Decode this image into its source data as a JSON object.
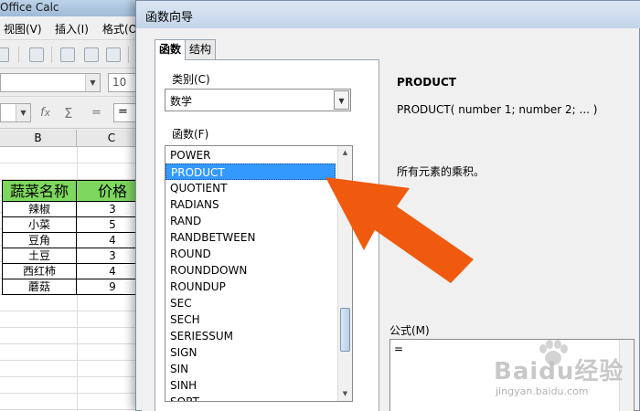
{
  "calc": {
    "title": "Office Calc",
    "menu": [
      "视图(V)",
      "插入(I)",
      "格式(O"
    ],
    "font_size": "10",
    "formula_value": "=",
    "column_headers": [
      "B",
      "C"
    ],
    "table": {
      "header": [
        "蔬菜名称",
        "价格"
      ],
      "rows": [
        [
          "辣椒",
          "3"
        ],
        [
          "小菜",
          "5"
        ],
        [
          "豆角",
          "4"
        ],
        [
          "土豆",
          "3"
        ],
        [
          "西红柿",
          "4"
        ],
        [
          "蘑菇",
          "9"
        ]
      ]
    }
  },
  "dialog": {
    "title": "函数向导",
    "tabs": [
      "函数",
      "结构"
    ],
    "category_label": "类别(C)",
    "category_value": "数学",
    "functions_label": "函数(F)",
    "functions": [
      "POWER",
      "PRODUCT",
      "QUOTIENT",
      "RADIANS",
      "RAND",
      "RANDBETWEEN",
      "ROUND",
      "ROUNDDOWN",
      "ROUNDUP",
      "SEC",
      "SECH",
      "SERIESSUM",
      "SIGN",
      "SIN",
      "SINH",
      "SQRT"
    ],
    "selected_function": "PRODUCT",
    "function_name": "PRODUCT",
    "function_syntax": "PRODUCT( number 1; number 2; ... )",
    "function_description": "所有元素的乘积。",
    "formula_label": "公式(M)",
    "formula_value": "="
  },
  "annotation": {
    "arrow_color": "#f05a0f"
  },
  "watermark": {
    "logo": "Baidu经验",
    "url": "jingyan.baidu.com"
  }
}
